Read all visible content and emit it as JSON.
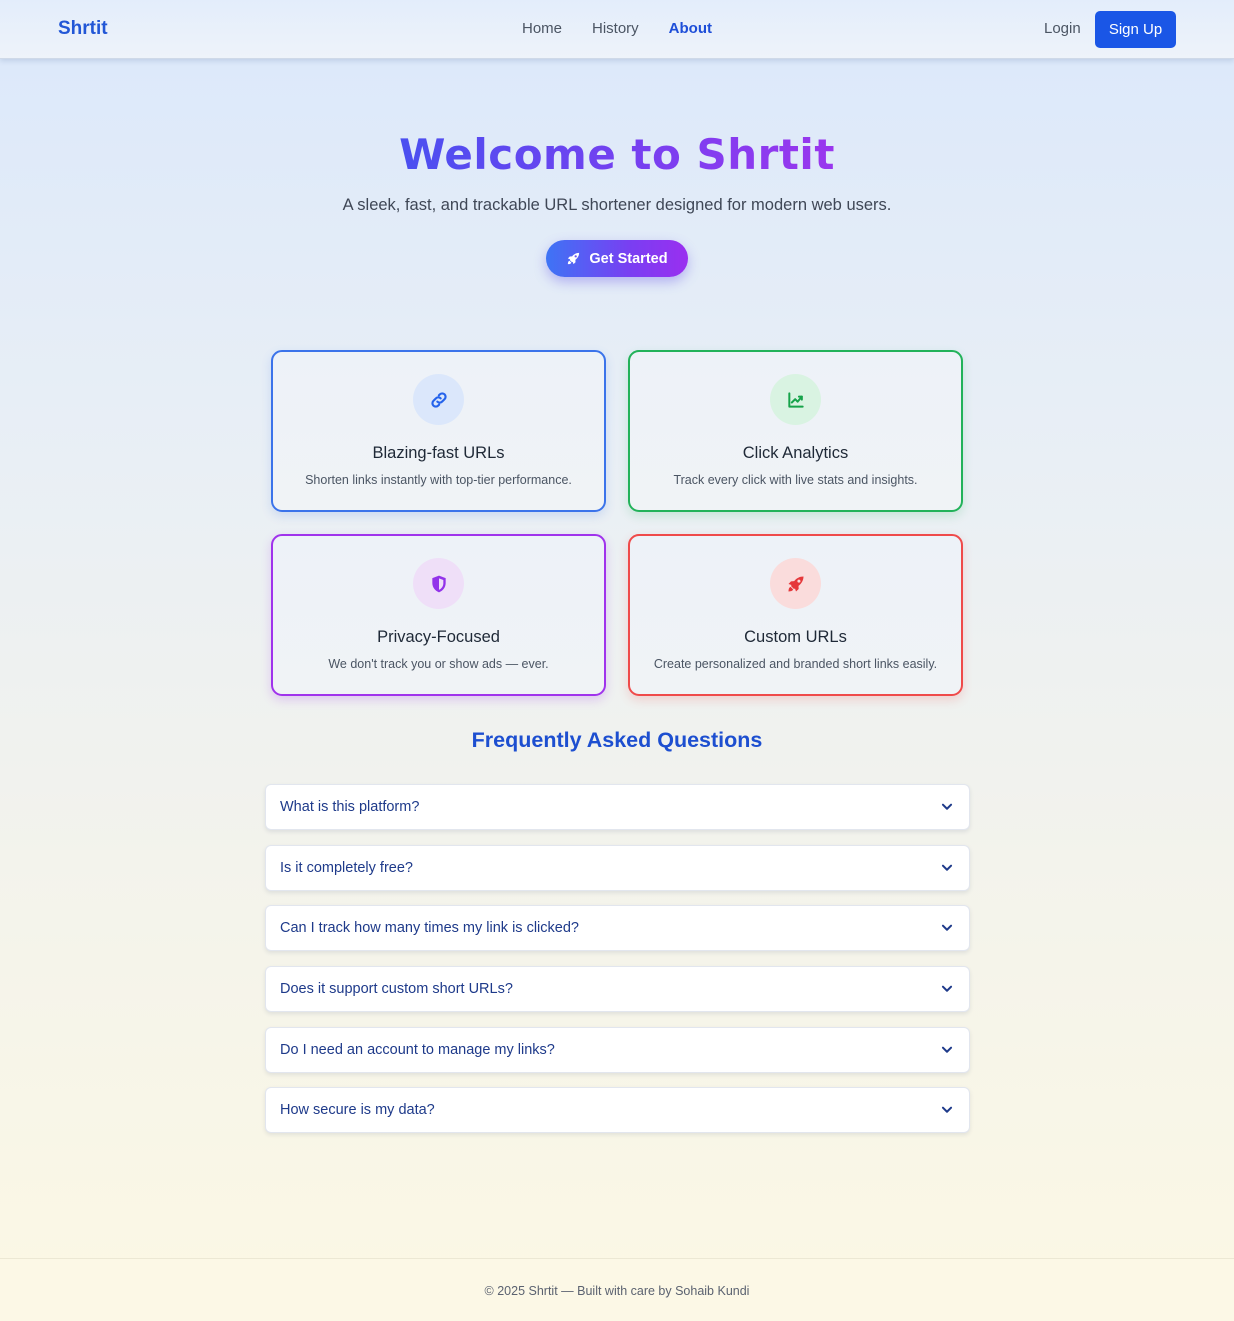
{
  "nav": {
    "brand": "Shrtit",
    "links": [
      {
        "label": "Home",
        "active": false
      },
      {
        "label": "History",
        "active": false
      },
      {
        "label": "About",
        "active": true
      }
    ],
    "login_label": "Login",
    "signup_label": "Sign Up"
  },
  "hero": {
    "title": "Welcome to Shrtit",
    "subtitle": "A sleek, fast, and trackable URL shortener designed for modern web users.",
    "cta_label": "Get Started",
    "cta_icon": "rocket-icon"
  },
  "features": [
    {
      "title": "Blazing-fast URLs",
      "description": "Shorten links instantly with top-tier performance.",
      "icon": "link-icon",
      "color": "#3b73ea"
    },
    {
      "title": "Click Analytics",
      "description": "Track every click with live stats and insights.",
      "icon": "chart-line-icon",
      "color": "#22b25a"
    },
    {
      "title": "Privacy-Focused",
      "description": "We don't track you or show ads — ever.",
      "icon": "shield-icon",
      "color": "#a033ec"
    },
    {
      "title": "Custom URLs",
      "description": "Create personalized and branded short links easily.",
      "icon": "rocket-icon",
      "color": "#ef4a4a"
    }
  ],
  "faq": {
    "heading": "Frequently Asked Questions",
    "items": [
      {
        "question": "What is this platform?"
      },
      {
        "question": "Is it completely free?"
      },
      {
        "question": "Can I track how many times my link is clicked?"
      },
      {
        "question": "Does it support custom short URLs?"
      },
      {
        "question": "Do I need an account to manage my links?"
      },
      {
        "question": "How secure is my data?"
      }
    ]
  },
  "footer": {
    "text": "© 2025 Shrtit — Built with care by Sohaib Kundi"
  },
  "colors": {
    "primary": "#1a56e6",
    "accent_purple": "#7a3ef2"
  }
}
